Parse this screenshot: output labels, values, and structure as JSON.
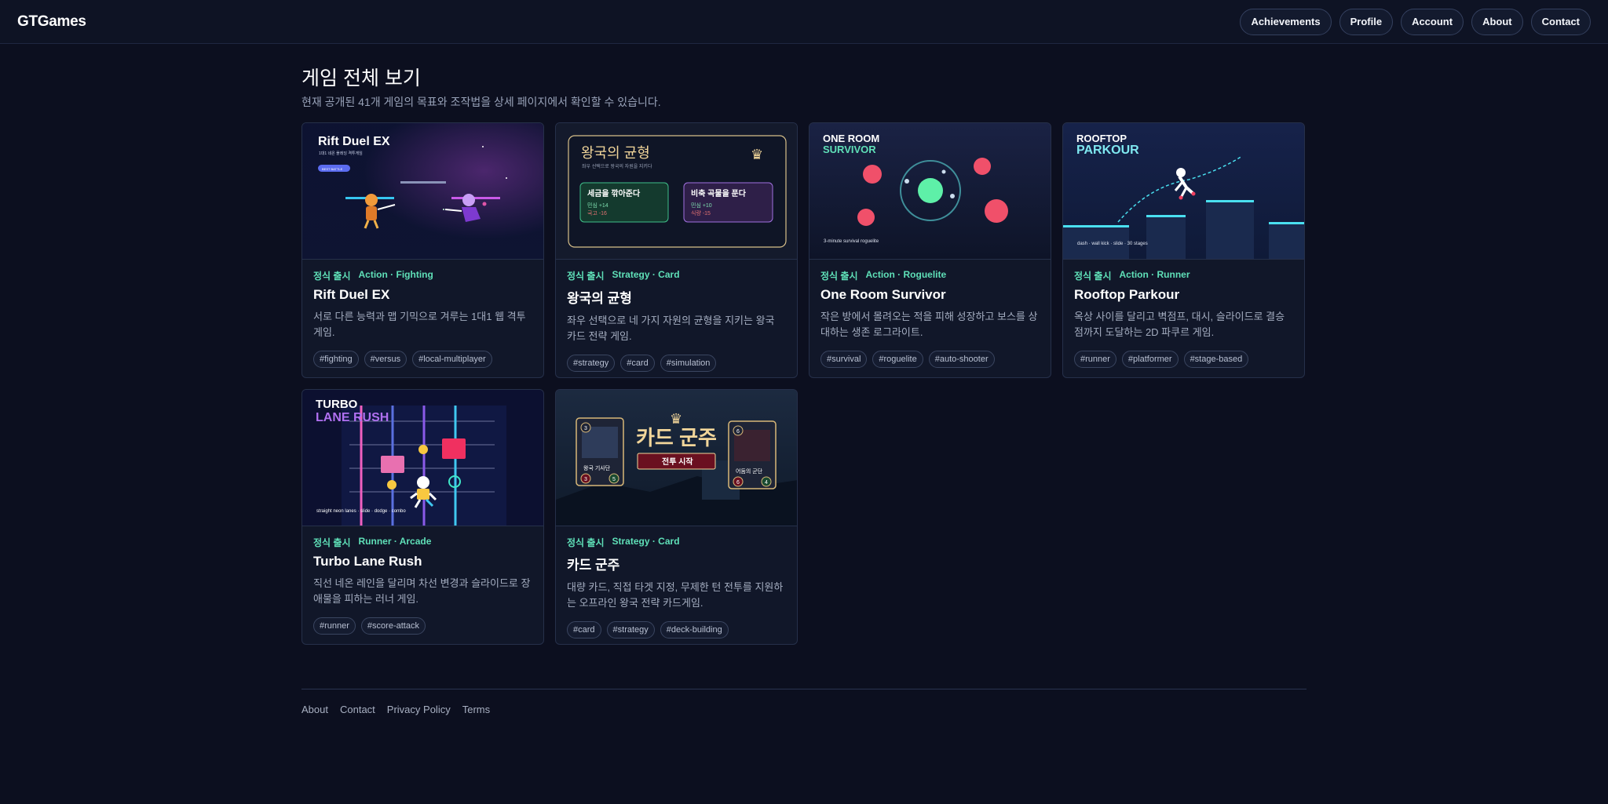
{
  "header": {
    "brand": "GTGames",
    "nav": [
      "Achievements",
      "Profile",
      "Account",
      "About",
      "Contact"
    ]
  },
  "page": {
    "title": "게임 전체 보기",
    "subtitle": "현재 공개된 41개 게임의 목표와 조작법을 상세 페이지에서 확인할 수 있습니다."
  },
  "games": [
    {
      "status": "정식 출시",
      "genre": "Action · Fighting",
      "title": "Rift Duel EX",
      "desc": "서로 다른 능력과 맵 기믹으로 겨루는 1대1 웹 격투 게임.",
      "tags": [
        "#fighting",
        "#versus",
        "#local-multiplayer"
      ],
      "thumb": {
        "title": "Rift Duel EX",
        "subtitle": "1대1 네온 플레잉 격투게임",
        "pill": "BEST BATTLE"
      }
    },
    {
      "status": "정식 출시",
      "genre": "Strategy · Card",
      "title": "왕국의 균형",
      "desc": "좌우 선택으로 네 가지 자원의 균형을 지키는 왕국 카드 전략 게임.",
      "tags": [
        "#strategy",
        "#card",
        "#simulation"
      ],
      "thumb": {
        "title": "왕국의 균형",
        "subtitle": "좌우 선택으로 왕국의 자원을 지키다",
        "left_choice": "세금을 깎아준다",
        "left_stat1": "민심 +14",
        "left_stat2": "국고 -16",
        "right_choice": "비축 곡물을 푼다",
        "right_stat1": "민심 +10",
        "right_stat2": "식량 -15"
      }
    },
    {
      "status": "정식 출시",
      "genre": "Action · Roguelite",
      "title": "One Room Survivor",
      "desc": "작은 방에서 몰려오는 적을 피해 성장하고 보스를 상대하는 생존 로그라이트.",
      "tags": [
        "#survival",
        "#roguelite",
        "#auto-shooter"
      ],
      "thumb": {
        "title1": "ONE ROOM",
        "title2": "SURVIVOR",
        "caption": "3-minute survival roguelite"
      }
    },
    {
      "status": "정식 출시",
      "genre": "Action · Runner",
      "title": "Rooftop Parkour",
      "desc": "옥상 사이를 달리고 벽점프, 대시, 슬라이드로 결승점까지 도달하는 2D 파쿠르 게임.",
      "tags": [
        "#runner",
        "#platformer",
        "#stage-based"
      ],
      "thumb": {
        "title1": "ROOFTOP",
        "title2": "PARKOUR",
        "caption": "dash · wall kick · slide · 30 stages"
      }
    },
    {
      "status": "정식 출시",
      "genre": "Runner · Arcade",
      "title": "Turbo Lane Rush",
      "desc": "직선 네온 레인을 달리며 차선 변경과 슬라이드로 장애물을 피하는 러너 게임.",
      "tags": [
        "#runner",
        "#score-attack"
      ],
      "thumb": {
        "title1": "TURBO",
        "title2": "LANE RUSH",
        "caption": "straight neon lanes · slide · dodge · combo"
      }
    },
    {
      "status": "정식 출시",
      "genre": "Strategy · Card",
      "title": "카드 군주",
      "desc": "대량 카드, 직접 타겟 지정, 무제한 턴 전투를 지원하는 오프라인 왕국 전략 카드게임.",
      "tags": [
        "#card",
        "#strategy",
        "#deck-building"
      ],
      "thumb": {
        "title": "카드 군주",
        "button": "전투 시작",
        "left_card": "왕국 기사단",
        "left_cost": "3",
        "left_atk": "3",
        "left_hp": "5",
        "right_card": "어둠의 군단",
        "right_cost": "6",
        "right_atk": "6",
        "right_hp": "4"
      }
    }
  ],
  "footer": {
    "links": [
      "About",
      "Contact",
      "Privacy Policy",
      "Terms"
    ]
  },
  "colors": {
    "background": "#0c0f1f",
    "accent": "#5fe0b8",
    "card": "#111729"
  }
}
